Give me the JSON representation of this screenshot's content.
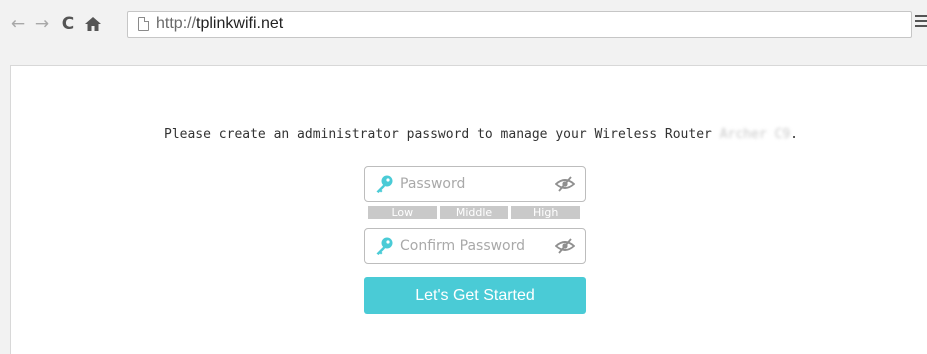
{
  "browser": {
    "url_protocol": "http://",
    "url_host": "tplinkwifi.net",
    "back_icon": "←",
    "forward_icon": "→",
    "reload_icon": "C",
    "home_icon": "⌂"
  },
  "setup": {
    "prompt_text": "Please create an administrator password to manage your Wireless Router ",
    "model_name_blurred": "Archer C9",
    "prompt_end": ".",
    "password_placeholder": "Password",
    "confirm_placeholder": "Confirm Password",
    "strength_levels": [
      "Low",
      "Middle",
      "High"
    ],
    "submit_label": "Let's Get Started"
  },
  "colors": {
    "accent": "#4acbd6",
    "strength_bar": "#c9c9c9"
  }
}
